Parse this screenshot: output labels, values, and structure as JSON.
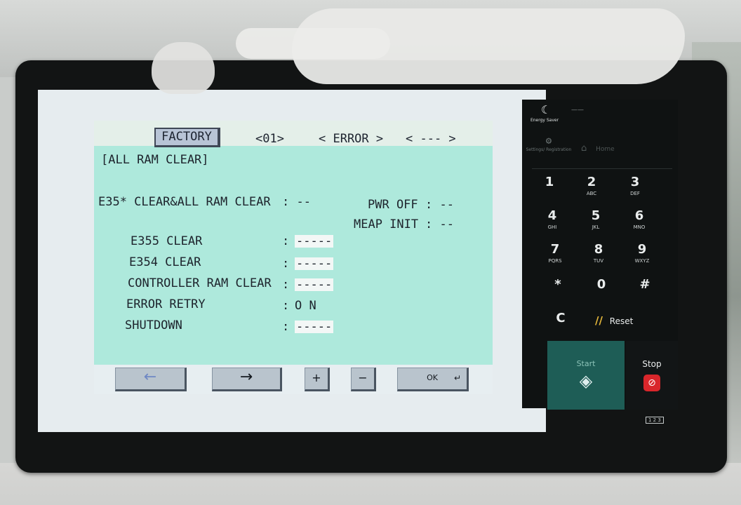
{
  "header": {
    "tab_label": "FACTORY",
    "index": "<01>",
    "mode": "< ERROR >",
    "page": "< --- >"
  },
  "main": {
    "title": "[ALL RAM CLEAR]",
    "items": [
      {
        "label": "E35* CLEAR&ALL RAM CLEAR",
        "value": ": --"
      },
      {
        "label": "PWR OFF",
        "value": ": --"
      },
      {
        "label": "MEAP INIT",
        "value": ": --"
      },
      {
        "label": "E355 CLEAR",
        "value": "-----"
      },
      {
        "label": "E354 CLEAR",
        "value": "-----"
      },
      {
        "label": "CONTROLLER RAM CLEAR",
        "value": "-----"
      },
      {
        "label": "ERROR RETRY",
        "value": "O N"
      },
      {
        "label": "SHUTDOWN",
        "value": "-----"
      }
    ],
    "colon": ":"
  },
  "buttons": {
    "left_arrow": "←",
    "right_arrow": "→",
    "plus": "+",
    "minus": "−",
    "ok": "OK"
  },
  "keypad": {
    "energy_saver": "Energy Saver",
    "status_dash": "——",
    "settings_label": "Settings/ Registration",
    "home_label": "Home",
    "keys": [
      {
        "num": "1",
        "sub": ""
      },
      {
        "num": "2",
        "sub": "ABC"
      },
      {
        "num": "3",
        "sub": "DEF"
      },
      {
        "num": "4",
        "sub": "GHI"
      },
      {
        "num": "5",
        "sub": "JKL"
      },
      {
        "num": "6",
        "sub": "MNO"
      },
      {
        "num": "7",
        "sub": "PQRS"
      },
      {
        "num": "8",
        "sub": "TUV"
      },
      {
        "num": "9",
        "sub": "WXYZ"
      },
      {
        "num": "*",
        "sub": ""
      },
      {
        "num": "0",
        "sub": ""
      },
      {
        "num": "#",
        "sub": ""
      }
    ],
    "clear": "C",
    "reset": "Reset",
    "start": "Start",
    "stop": "Stop",
    "counter": "1 2 3"
  },
  "colors": {
    "panel": "#aee9dc",
    "start": "#1e5d56",
    "stop_icon": "#d9262b"
  }
}
